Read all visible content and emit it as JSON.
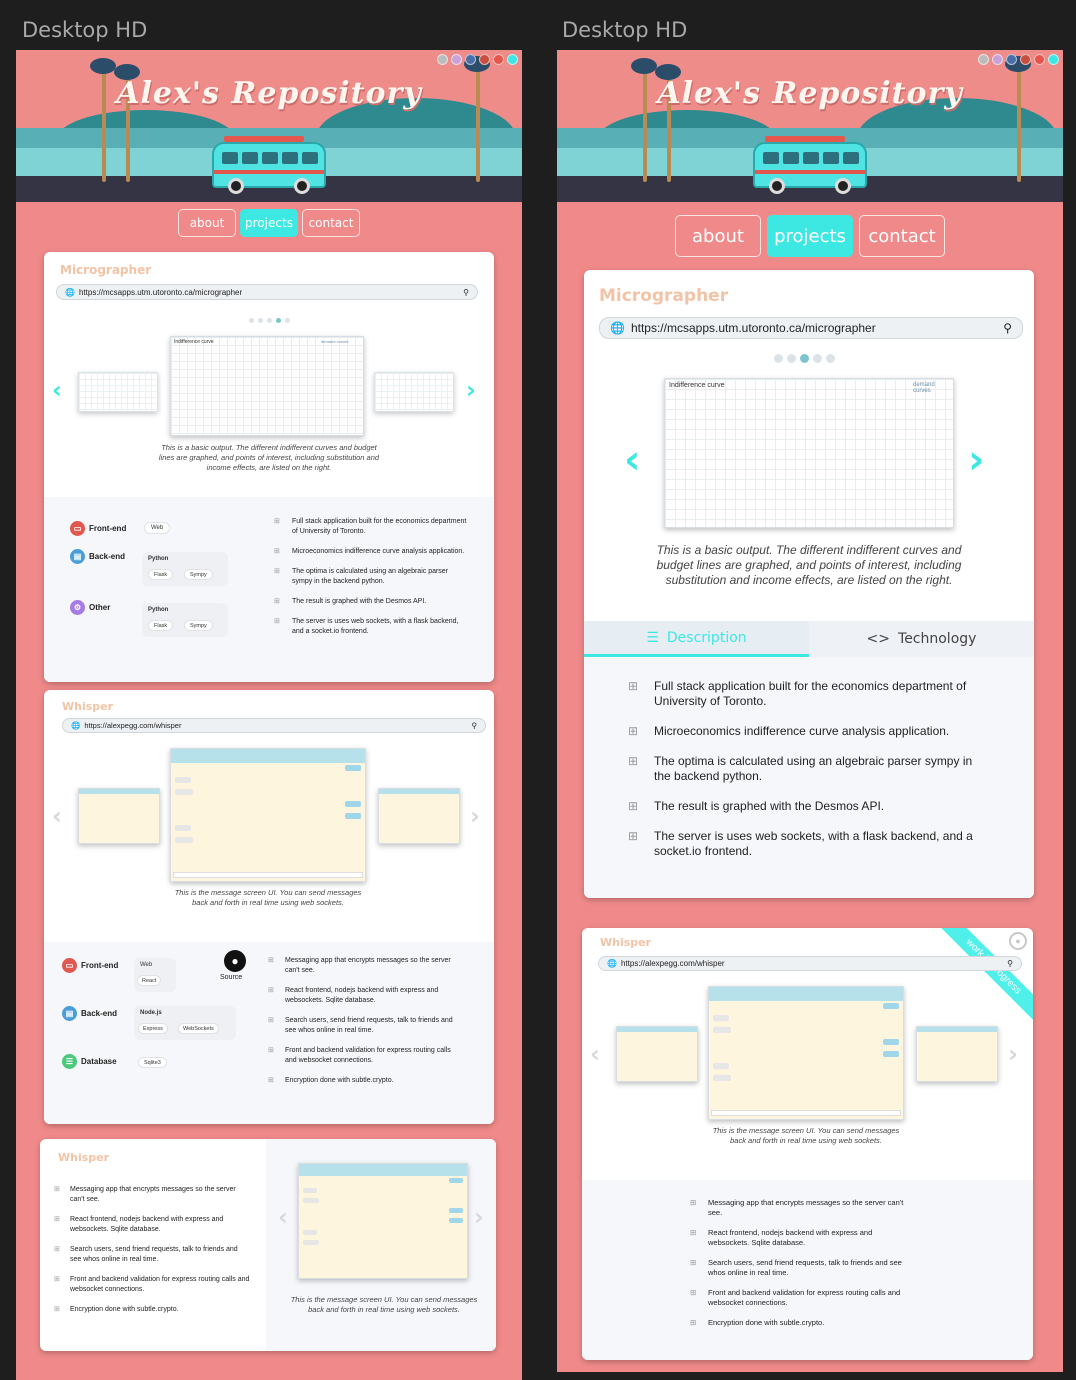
{
  "frames": [
    {
      "title": "Desktop HD"
    },
    {
      "title": "Desktop HD"
    }
  ],
  "hero": {
    "title": "Alex's Repository",
    "swatch_colors": [
      "#bcbcbc",
      "#c9a2d8",
      "#4a6ea8",
      "#c64f3f",
      "#e6554c",
      "#3de8e3"
    ]
  },
  "nav": {
    "items": [
      "about",
      "projects",
      "contact"
    ],
    "active": "projects"
  },
  "micrographer": {
    "name": "Micrographer",
    "url": "https://mcsapps.utm.utoronto.ca/micrographer",
    "caption": "This is a basic output. The different indifferent curves and budget lines are graphed, and points of interest, including substitution and income effects, are listed on the right.",
    "shot_title": "Indifference curve",
    "shot_subtitle": "analysis",
    "shot_link": "demand curves",
    "tabs": [
      "Description",
      "Technology"
    ],
    "description": [
      "Full stack application built for the economics department of University of Toronto.",
      "Microeconomics indifference curve analysis application.",
      "The optima is calculated using an algebraic parser sympy in the backend python.",
      "The result is graphed with the Desmos API.",
      "The server is uses web sockets, with a flask backend, and a socket.io frontend."
    ],
    "tech": {
      "frontend_label": "Front-end",
      "frontend_chips": [
        "Web"
      ],
      "backend_label": "Back-end",
      "backend_title": "Python",
      "backend_chips": [
        "Flask",
        "Sympy"
      ],
      "other_label": "Other",
      "other_title": "Python",
      "other_chips": [
        "Flask",
        "Sympy"
      ]
    }
  },
  "whisper": {
    "name": "Whisper",
    "url": "https://alexpegg.com/whisper",
    "caption": "This is the message screen UI. You can send messages back and forth in real time using web sockets.",
    "ribbon": "work in progress",
    "source_label": "Source",
    "description": [
      "Messaging app that encrypts messages so the server can't see.",
      "React frontend, nodejs backend with express and websockets. Sqlite database.",
      "Search users, send friend requests, talk to friends and see whos online in real time.",
      "Front and backend validation for express routing calls and websocket connections.",
      "Encryption done with subtle.crypto."
    ],
    "tech": {
      "frontend_label": "Front-end",
      "frontend_title": "Web",
      "frontend_chips": [
        "React"
      ],
      "backend_label": "Back-end",
      "backend_title": "Node.js",
      "backend_chips": [
        "Express",
        "WebSockets"
      ],
      "database_label": "Database",
      "database_chips": [
        "Sqlite3"
      ]
    }
  },
  "icons": {
    "globe": "globe-icon",
    "search": "search-icon",
    "bullet": "arrow-circle-icon",
    "prev": "chevron-left-icon",
    "next": "chevron-right-icon",
    "github": "github-icon"
  },
  "colors": {
    "accent": "#3de8e3",
    "page_bg": "#f08a8a",
    "project_title": "#f3c3a5",
    "frontend": "#e0584f",
    "backend": "#4a9fd8",
    "other": "#a77be6",
    "database": "#4cc97a"
  }
}
